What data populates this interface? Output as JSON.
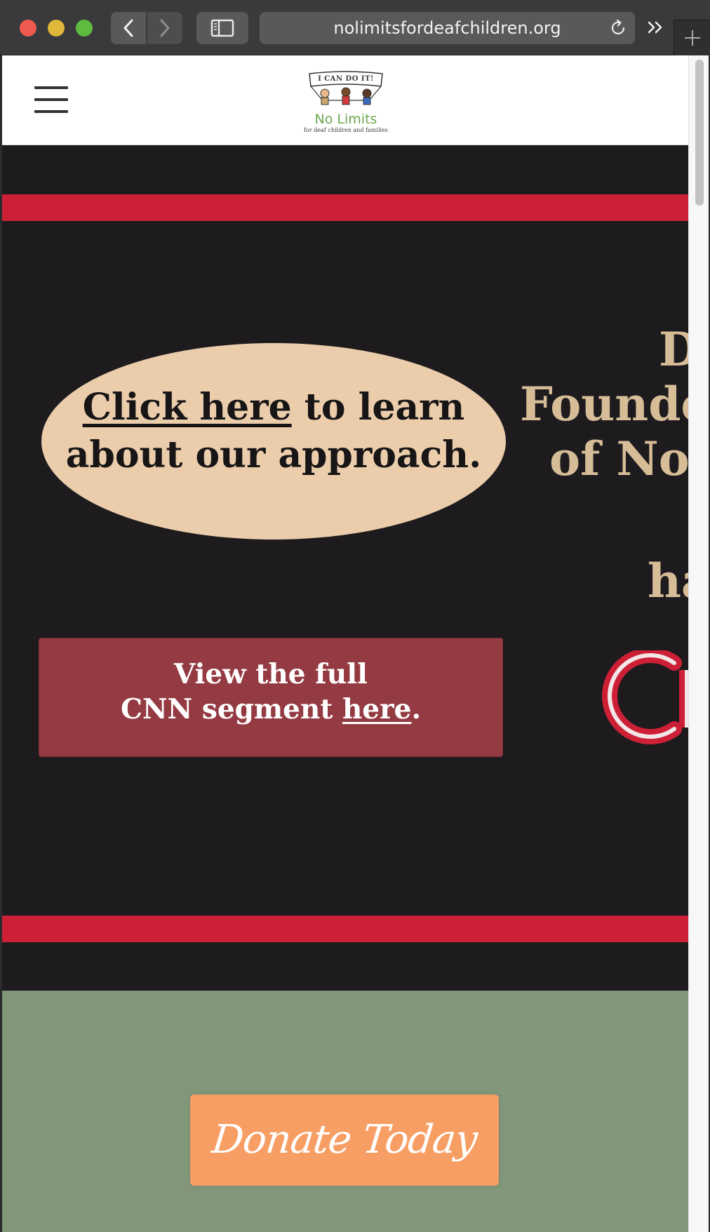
{
  "browser": {
    "url": "nolimitsfordeafchildren.org"
  },
  "header": {
    "logo": {
      "banner_text": "I CAN DO IT!",
      "brand_name": "No Limits",
      "tagline": "for deaf children and families"
    }
  },
  "hero": {
    "approach": {
      "link_text": "Click here",
      "line1_rest": " to learn",
      "line2": "about our approach."
    },
    "cnn": {
      "line1": "View the full",
      "line2_prefix": "CNN segment ",
      "link_text": "here",
      "line2_suffix": "."
    },
    "side_heading": {
      "line1": "D",
      "line2": "Founde",
      "line3": "of No",
      "line4": "ha"
    }
  },
  "donate": {
    "label": "Donate Today"
  },
  "colors": {
    "accent_red": "#cd2036",
    "dark_background": "#1d1b1d",
    "oval_beige": "#ebcdab",
    "cnn_box": "#943a42",
    "green_section": "#82967a",
    "donate_orange": "#f79e64"
  }
}
